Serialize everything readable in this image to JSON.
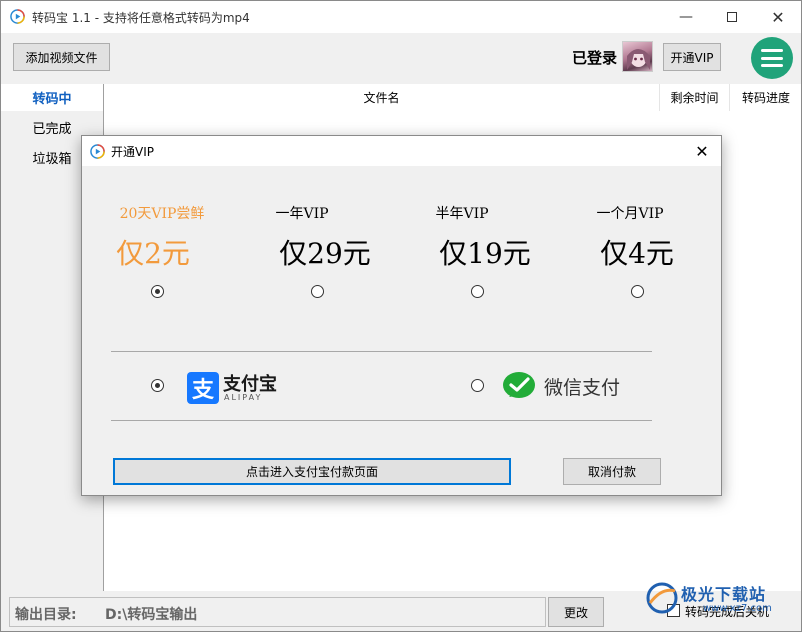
{
  "window": {
    "title": "转码宝 1.1 - 支持将任意格式转码为mp4",
    "minimize_icon": "minimize-icon",
    "maximize_icon": "maximize-icon",
    "close_icon": "close-icon"
  },
  "toolbar": {
    "add_video_label": "添加视频文件",
    "login_status": "已登录",
    "vip_button_label": "开通VIP",
    "menu_icon": "hamburger-menu-icon",
    "accent_color": "#20a37a"
  },
  "sidebar": {
    "items": [
      {
        "label": "转码中",
        "active": true
      },
      {
        "label": "已完成",
        "active": false
      },
      {
        "label": "垃圾箱",
        "active": false
      }
    ]
  },
  "list": {
    "columns": [
      "文件名",
      "剩余时间",
      "转码进度"
    ]
  },
  "bottom": {
    "output_label": "输出目录:",
    "output_path": "D:\\转码宝输出",
    "change_button": "更改",
    "shutdown_label": "转码完成后关机",
    "shutdown_checked": false
  },
  "watermark": {
    "text": "极光下载站",
    "sub": "www.xz7.com"
  },
  "dialog": {
    "title": "开通VIP",
    "close_icon": "close-icon",
    "plans": [
      {
        "name": "20天VIP尝鲜",
        "price": "仅2元",
        "selected": true,
        "highlight": "#f29a3c"
      },
      {
        "name": "一年VIP",
        "price": "仅29元",
        "selected": false
      },
      {
        "name": "半年VIP",
        "price": "仅19元",
        "selected": false
      },
      {
        "name": "一个月VIP",
        "price": "仅4元",
        "selected": false
      }
    ],
    "payment": {
      "alipay": {
        "icon": "alipay-logo",
        "glyph": "支",
        "name": "支付宝",
        "sub": "ALIPAY",
        "selected": true,
        "color": "#1678ff"
      },
      "wechat": {
        "icon": "wechat-pay-logo",
        "name": "微信支付",
        "selected": false,
        "color": "#22ac38"
      }
    },
    "pay_button": "点击进入支付宝付款页面",
    "cancel_button": "取消付款"
  }
}
